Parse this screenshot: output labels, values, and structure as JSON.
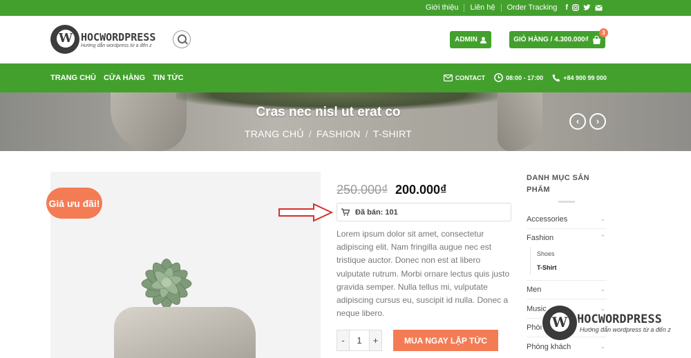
{
  "topbar": {
    "links": [
      "Giới thiệu",
      "Liên hệ",
      "Order Tracking"
    ],
    "social_icons": [
      "facebook-icon",
      "instagram-icon",
      "twitter-icon",
      "mail-icon"
    ]
  },
  "header": {
    "logo_title": "HOCWORDPRESS",
    "logo_subtitle": "Hướng dẫn wordpress từ a đến z",
    "admin_label": "ADMIN",
    "cart_label": "GIỎ HÀNG / 4.300.000₫",
    "cart_count": "3"
  },
  "nav": {
    "menu": [
      "TRANG CHỦ",
      "CỬA HÀNG",
      "TIN TỨC"
    ],
    "contact": "CONTACT",
    "hours": "08:00 - 17:00",
    "phone": "+84 900 99 000"
  },
  "hero": {
    "title": "Cras nec nisl ut erat co",
    "breadcrumb": [
      "TRANG CHỦ",
      "FASHION",
      "T-SHIRT"
    ],
    "prev_arrow": "‹",
    "next_arrow": "›"
  },
  "product": {
    "sale_badge": "Giá ưu đãi!",
    "price_old": "250.000₫",
    "price_new": "200.000₫",
    "sold": "Đã bán: 101",
    "description": "Lorem ipsum dolor sit amet, consectetur adipiscing elit. Nam fringilla augue nec est tristique auctor. Donec non est at libero vulputate rutrum. Morbi ornare lectus quis justo gravida semper. Nulla tellus mi, vulputate adipiscing cursus eu, suscipit id nulla. Donec a neque libero.",
    "qty_minus": "-",
    "qty_value": "1",
    "qty_plus": "+",
    "buy_label": "MUA NGAY LẬP TỨC"
  },
  "sidebar": {
    "title": "DANH MỤC SẢN PHẨM",
    "categories": [
      {
        "label": "Accessories",
        "chevron": "down"
      },
      {
        "label": "Fashion",
        "chevron": "up"
      },
      {
        "label": "Men",
        "chevron": "down"
      },
      {
        "label": "Music",
        "chevron": "down"
      },
      {
        "label": "Phòng",
        "chevron": "down"
      },
      {
        "label": "Phòng khách",
        "chevron": "down"
      }
    ],
    "subcategories": [
      "Shoes",
      "T-Shirt"
    ]
  },
  "watermark": {
    "title": "HOCWORDPRESS",
    "subtitle": "Hướng dẫn wordpress từ a đến z"
  },
  "colors": {
    "brand_green": "#43a02d",
    "accent_orange": "#f47c54",
    "annotation_red": "#d62f2f"
  }
}
